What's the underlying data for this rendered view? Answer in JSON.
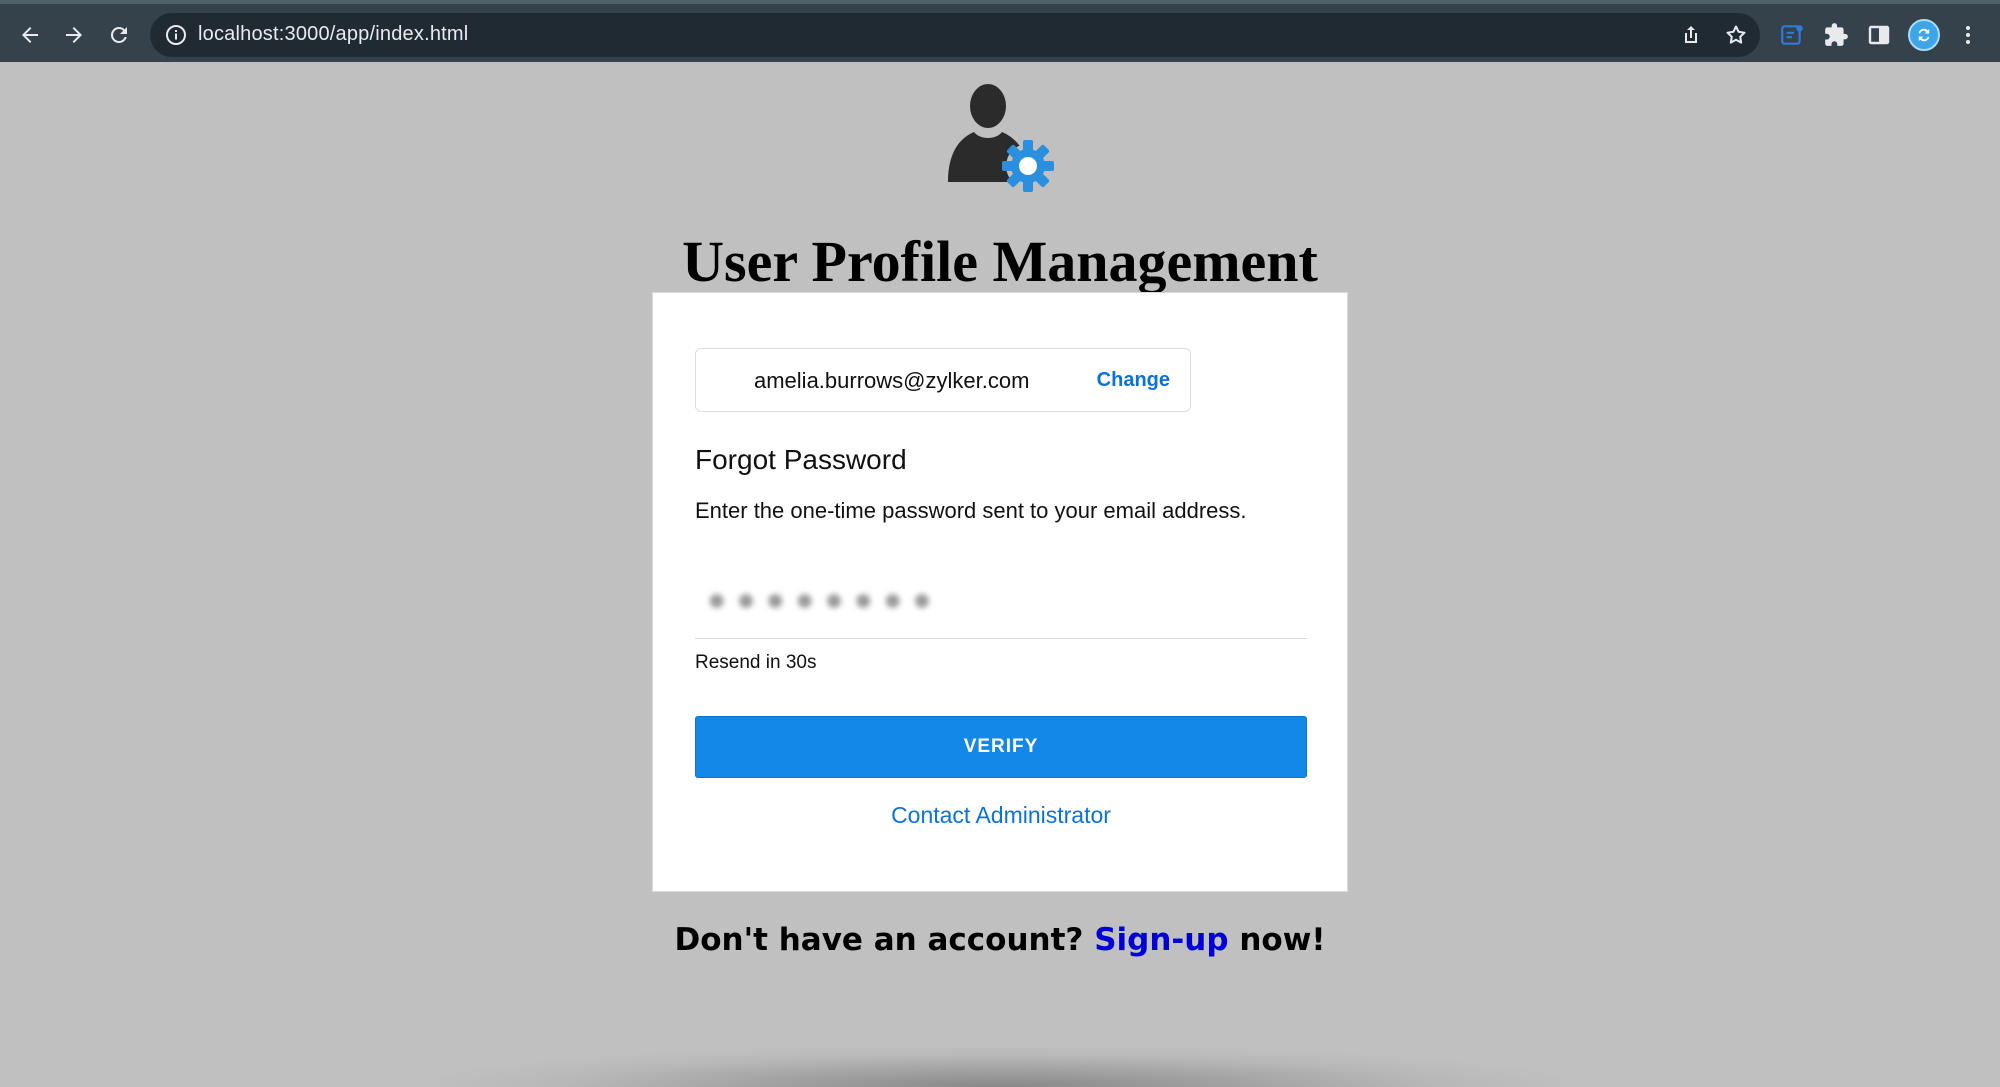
{
  "browser": {
    "url": "localhost:3000/app/index.html",
    "icons": [
      "back-arrow-icon",
      "forward-arrow-icon",
      "reload-icon",
      "site-info-icon",
      "share-icon",
      "bookmark-star-icon",
      "extension-icon",
      "puzzle-extensions-icon",
      "side-panel-icon",
      "profile-avatar-icon",
      "menu-kebab-icon"
    ]
  },
  "page": {
    "title": "User Profile Management",
    "logo_icon": "user-settings-icon"
  },
  "card": {
    "email": "amelia.burrows@zylker.com",
    "change_label": "Change",
    "heading": "Forgot Password",
    "description": "Enter the one-time password sent to your email address.",
    "otp_value": "●●●●●●●●",
    "resend_text": "Resend in 30s",
    "verify_label": "VERIFY",
    "contact_label": "Contact Administrator"
  },
  "footer": {
    "prefix": "Don't have an account? ",
    "signup_label": "Sign-up",
    "suffix": " now!"
  },
  "colors": {
    "chrome_bg": "#35414b",
    "page_bg": "#c0c0c0",
    "accent": "#1488e6",
    "link": "#0b72d8",
    "signup_link": "#0000d6"
  }
}
